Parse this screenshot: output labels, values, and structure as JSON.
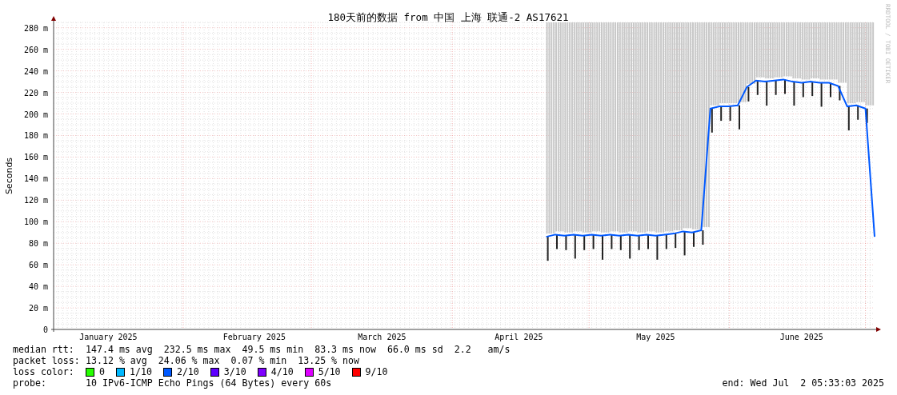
{
  "chart": {
    "side_text": "RRDTOOL / TOBI OETIKER",
    "chart_data": {
      "type": "line",
      "grid": true,
      "title": "180天前的数据 from 中国 上海 联通-2 AS17621",
      "ylabel": "Seconds",
      "ylim": [
        0,
        285
      ],
      "categories": [
        null,
        null,
        null,
        null,
        null,
        null,
        "January 2025",
        null,
        null,
        null,
        null,
        null,
        null,
        null,
        null,
        null,
        null,
        null,
        null,
        null,
        null,
        null,
        "February 2025",
        null,
        null,
        null,
        null,
        null,
        null,
        null,
        null,
        null,
        null,
        null,
        null,
        null,
        "March 2025",
        null,
        null,
        null,
        null,
        null,
        null,
        null,
        null,
        null,
        null,
        null,
        null,
        null,
        null,
        "April 2025",
        null,
        null,
        null,
        null,
        null,
        null,
        null,
        null,
        null,
        null,
        null,
        null,
        null,
        null,
        "May 2025",
        null,
        null,
        null,
        null,
        null,
        null,
        null,
        null,
        null,
        null,
        null,
        null,
        null,
        null,
        null,
        "June 2025",
        null,
        null,
        null,
        null,
        null,
        null,
        null,
        null
      ],
      "yticks": [
        {
          "value": 0,
          "label": "0"
        },
        {
          "value": 20,
          "label": "20 m"
        },
        {
          "value": 40,
          "label": "40 m"
        },
        {
          "value": 60,
          "label": "60 m"
        },
        {
          "value": 80,
          "label": "80 m"
        },
        {
          "value": 100,
          "label": "100 m"
        },
        {
          "value": 120,
          "label": "120 m"
        },
        {
          "value": 140,
          "label": "140 m"
        },
        {
          "value": 160,
          "label": "160 m"
        },
        {
          "value": 180,
          "label": "180 m"
        },
        {
          "value": 200,
          "label": "200 m"
        },
        {
          "value": 220,
          "label": "220 m"
        },
        {
          "value": 240,
          "label": "240 m"
        },
        {
          "value": 260,
          "label": "260 m"
        },
        {
          "value": 280,
          "label": "280 m"
        }
      ],
      "series": [
        {
          "color": "#0059ff",
          "values": [
            null,
            null,
            null,
            null,
            null,
            null,
            null,
            null,
            null,
            null,
            null,
            null,
            null,
            null,
            null,
            null,
            null,
            null,
            null,
            null,
            null,
            null,
            null,
            null,
            null,
            null,
            null,
            null,
            null,
            null,
            null,
            null,
            null,
            null,
            null,
            null,
            null,
            null,
            null,
            null,
            null,
            null,
            null,
            null,
            null,
            null,
            null,
            null,
            null,
            null,
            null,
            null,
            null,
            null,
            86,
            88,
            87,
            88,
            87,
            88,
            87,
            88,
            87,
            88,
            87,
            88,
            87,
            88,
            89,
            91,
            90,
            92,
            205,
            207,
            207,
            208,
            225,
            231,
            230,
            231,
            232,
            230,
            229,
            230,
            229,
            229,
            226,
            207,
            208,
            205,
            86
          ]
        }
      ]
    }
  },
  "stats": [
    {
      "label": "median rtt:",
      "text": "147.4 ms avg  232.5 ms max  49.5 ms min  83.3 ms now  66.0 ms sd  2.2   am/s"
    },
    {
      "label": "packet loss:",
      "text": "13.12 % avg  24.06 % max  0.07 % min  13.25 % now"
    }
  ],
  "loss_colors": {
    "label": "loss color:",
    "items": [
      {
        "label": "0",
        "color": "#26ff00"
      },
      {
        "label": "1/10",
        "color": "#00b8ff"
      },
      {
        "label": "2/10",
        "color": "#0059ff"
      },
      {
        "label": "3/10",
        "color": "#5e00ff"
      },
      {
        "label": "4/10",
        "color": "#7e00ff"
      },
      {
        "label": "5/10",
        "color": "#dd00ff"
      },
      {
        "label": "9/10",
        "color": "#ff0000"
      }
    ]
  },
  "probe": {
    "label": "probe:",
    "text": "10 IPv6-ICMP Echo Pings (64 Bytes) every 60s"
  },
  "end": "end: Wed Jul  2 05:33:03 2025"
}
